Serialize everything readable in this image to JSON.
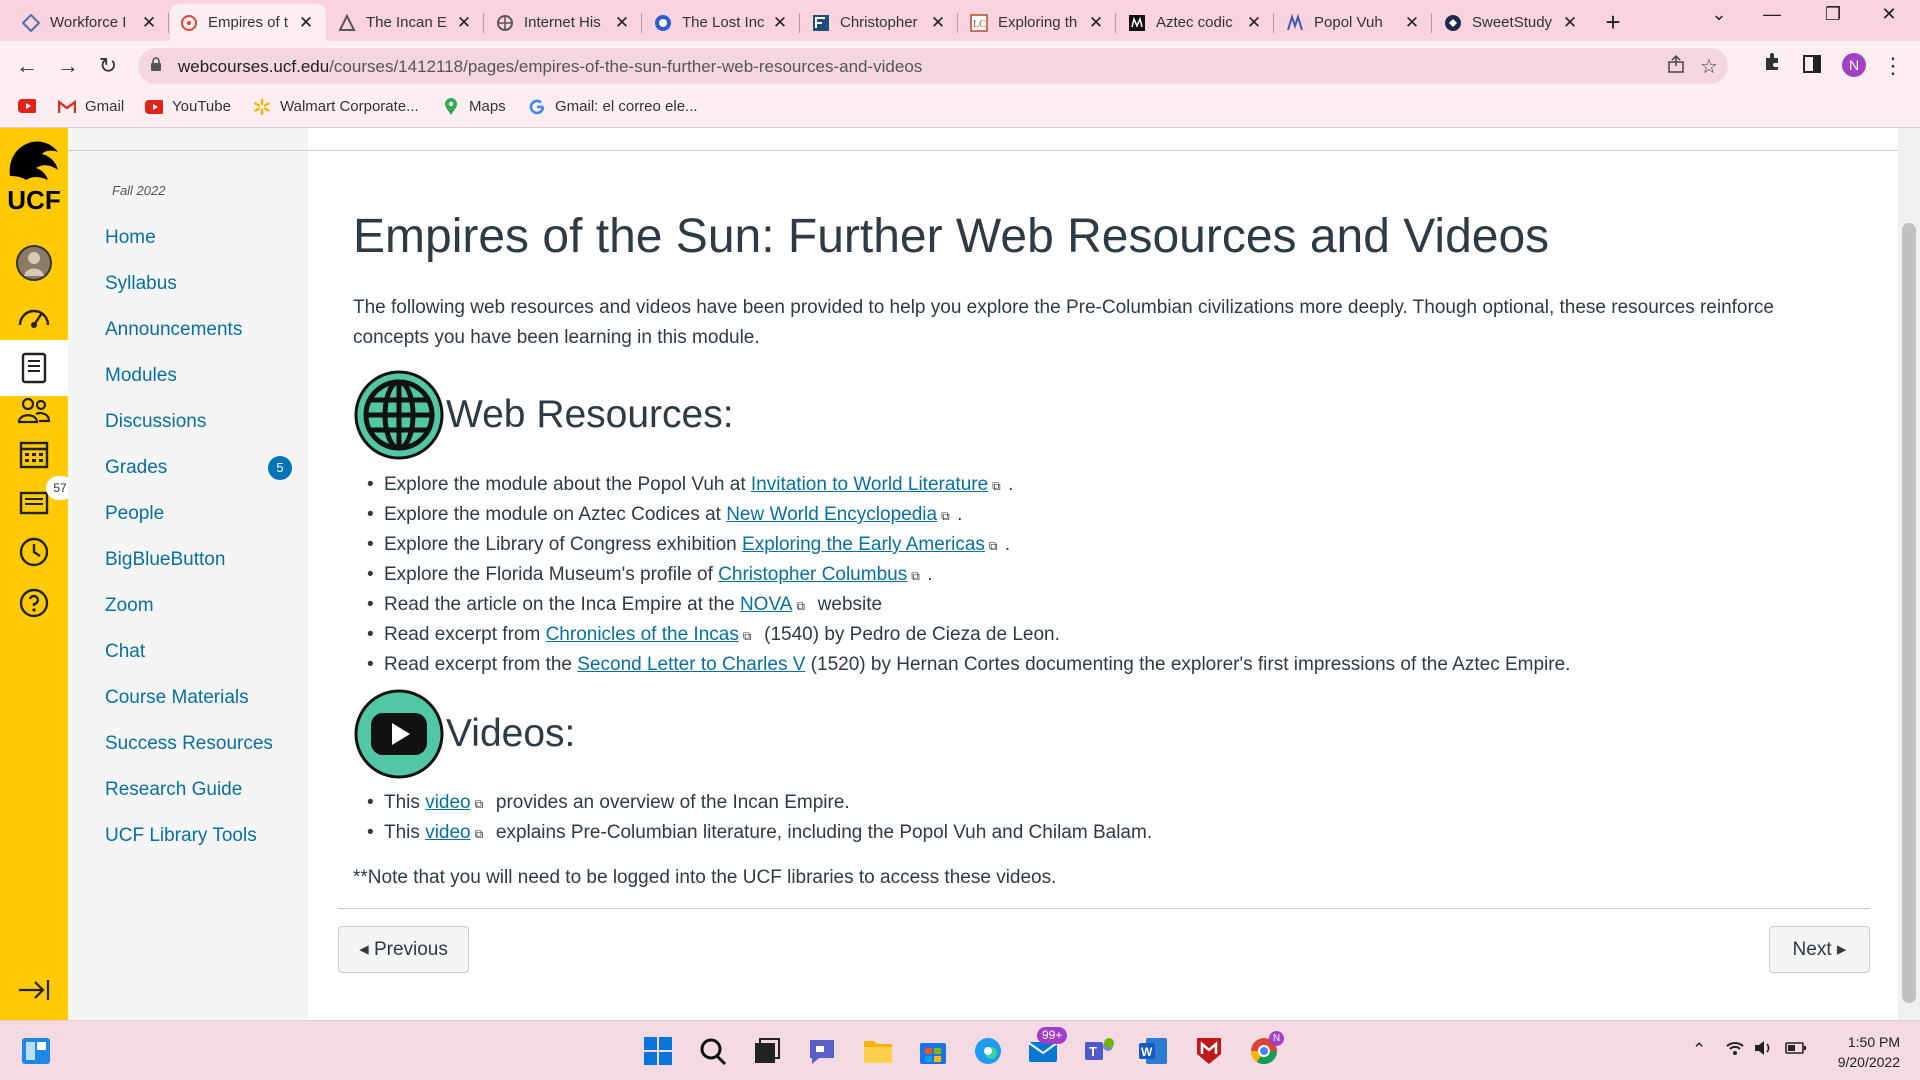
{
  "browser": {
    "tabs": [
      {
        "title": "Workforce I",
        "icon": "workforce-icon"
      },
      {
        "title": "Empires of t",
        "icon": "canvas-icon",
        "active": true
      },
      {
        "title": "The Incan E",
        "icon": "nova-icon"
      },
      {
        "title": "Internet His",
        "icon": "globe-icon"
      },
      {
        "title": "The Lost Inc",
        "icon": "lost-inc-icon"
      },
      {
        "title": "Christopher",
        "icon": "flmnh-icon"
      },
      {
        "title": "Exploring th",
        "icon": "loc-icon"
      },
      {
        "title": "Aztec codic",
        "icon": "nwe-icon"
      },
      {
        "title": "Popol Vuh",
        "icon": "wl-icon"
      },
      {
        "title": "SweetStudy",
        "icon": "sweetstudy-icon"
      }
    ],
    "new_tab": "+",
    "window_controls": {
      "menu": "⌄",
      "minimize": "—",
      "restore": "❐",
      "close": "✕"
    },
    "nav": {
      "back": "←",
      "forward": "→",
      "reload": "↻"
    },
    "url_host": "webcourses.ucf.edu",
    "url_path": "/courses/1412118/pages/empires-of-the-sun-further-web-resources-and-videos",
    "profile_initial": "N",
    "bookmarks": [
      {
        "label": "",
        "icon": "youtube-icon"
      },
      {
        "label": "Gmail",
        "icon": "gmail-icon"
      },
      {
        "label": "YouTube",
        "icon": "youtube-icon"
      },
      {
        "label": "Walmart Corporate...",
        "icon": "walmart-icon"
      },
      {
        "label": "Maps",
        "icon": "maps-icon"
      },
      {
        "label": "Gmail: el correo ele...",
        "icon": "google-icon"
      }
    ]
  },
  "global_nav": {
    "logo_text": "UCF",
    "items": [
      "account",
      "dashboard",
      "courses",
      "groups",
      "calendar",
      "inbox",
      "history",
      "help"
    ],
    "inbox_badge": "57",
    "collapse": "collapse-nav"
  },
  "course_nav": {
    "term": "Fall 2022",
    "items": [
      "Home",
      "Syllabus",
      "Announcements",
      "Modules",
      "Discussions",
      "Grades",
      "People",
      "BigBlueButton",
      "Zoom",
      "Chat",
      "Course Materials",
      "Success Resources",
      "Research Guide",
      "UCF Library Tools"
    ],
    "grades_badge": "5"
  },
  "page": {
    "title": "Empires of the Sun: Further Web Resources and Videos",
    "intro": "The following web resources and videos have been provided to help you explore the Pre-Columbian civilizations more deeply. Though optional, these resources reinforce concepts you have been learning in this module.",
    "web_heading": "Web Resources:",
    "resources": [
      {
        "before": "Explore the module about the Popol Vuh at ",
        "link": "Invitation to World Literature",
        "ext": true,
        "after": "."
      },
      {
        "before": "Explore the module on Aztec Codices at ",
        "link": "New World Encyclopedia",
        "ext": true,
        "after": "."
      },
      {
        "before": "Explore the Library of Congress exhibition ",
        "link": "Exploring the Early Americas",
        "ext": true,
        "after": "."
      },
      {
        "before": "Explore the Florida Museum's profile of ",
        "link": "Christopher Columbus",
        "ext": true,
        "after": "."
      },
      {
        "before": "Read the article on the Inca Empire at the ",
        "link": "NOVA",
        "ext": true,
        "after": " website"
      },
      {
        "before": "Read excerpt from ",
        "link": "Chronicles of the Incas",
        "ext": true,
        "after": " (1540) by Pedro de Cieza de Leon."
      },
      {
        "before": "Read excerpt from the ",
        "link": "Second Letter to Charles V",
        "ext": false,
        "after": " (1520) by Hernan Cortes documenting the explorer's first impressions of the Aztec Empire."
      }
    ],
    "videos_heading": "Videos:",
    "videos": [
      {
        "before": "This ",
        "link": "video",
        "ext": true,
        "after": " provides an overview of the Incan Empire."
      },
      {
        "before": "This ",
        "link": "video",
        "ext": true,
        "after": " explains Pre-Columbian literature, including the Popol Vuh and Chilam Balam."
      }
    ],
    "note": "**Note that you will need to be logged into the UCF libraries to access these videos.",
    "prev_label": "◂ Previous",
    "next_label": "Next ▸"
  },
  "taskbar": {
    "teams_badge": "99+",
    "chrome_badge": "N",
    "time": "1:50 PM",
    "date": "9/20/2022"
  },
  "colors": {
    "ucf_gold": "#ffc904",
    "link": "#0770a3",
    "chrome_pink": "#f9d3de",
    "icon_teal": "#52c7a4",
    "badge_blue": "#0374b5"
  }
}
